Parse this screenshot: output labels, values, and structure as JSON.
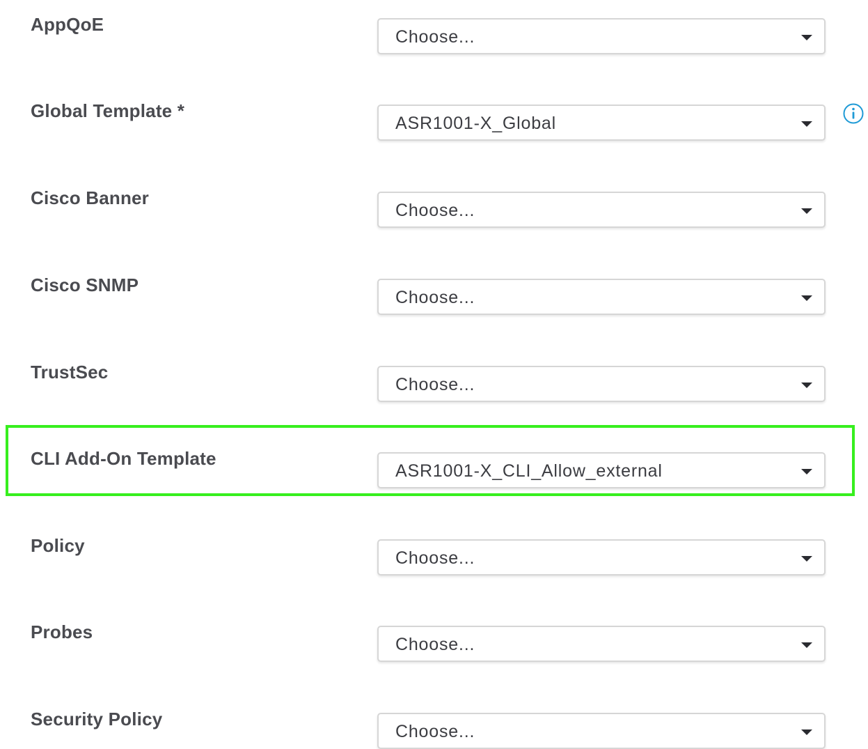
{
  "fields": [
    {
      "label": "AppQoE",
      "value": "Choose..."
    },
    {
      "label": "Global Template *",
      "value": "ASR1001-X_Global"
    },
    {
      "label": "Cisco Banner",
      "value": "Choose..."
    },
    {
      "label": "Cisco SNMP",
      "value": "Choose..."
    },
    {
      "label": "TrustSec",
      "value": "Choose..."
    },
    {
      "label": "CLI Add-On Template",
      "value": "ASR1001-X_CLI_Allow_external"
    },
    {
      "label": "Policy",
      "value": "Choose..."
    },
    {
      "label": "Probes",
      "value": "Choose..."
    },
    {
      "label": "Security Policy",
      "value": "Choose..."
    }
  ],
  "icons": {
    "dropdown": "chevron-down-icon",
    "info": "info-icon"
  },
  "colors": {
    "highlight": "#37ef1e",
    "info_icon": "#1e9ad6",
    "label": "#4a4b50"
  }
}
